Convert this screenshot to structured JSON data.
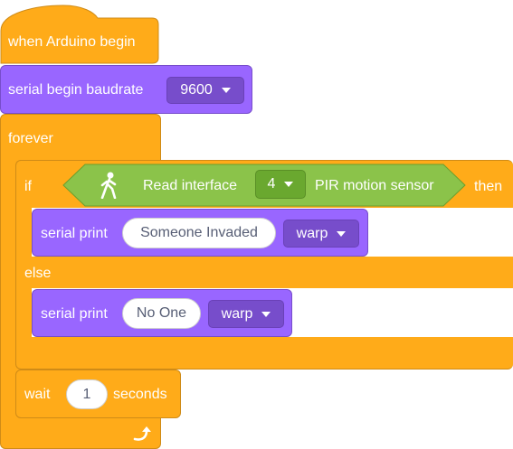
{
  "hat": {
    "label": "when Arduino begin"
  },
  "serial_begin": {
    "label": "serial begin baudrate",
    "baud": "9600"
  },
  "forever": {
    "label": "forever"
  },
  "if_block": {
    "if_label": "if",
    "then_label": "then",
    "else_label": "else",
    "condition": {
      "icon": "walking-person-icon",
      "label": "Read interface",
      "port": "4",
      "sensor": "PIR motion sensor"
    }
  },
  "print_invaded": {
    "label": "serial print",
    "text": "Someone Invaded",
    "mode": "warp"
  },
  "print_none": {
    "label": "serial print",
    "text": "No One",
    "mode": "warp"
  },
  "wait": {
    "label": "wait",
    "value": "1",
    "unit": "seconds"
  },
  "loop_icon": "loop-arrow-icon",
  "colors": {
    "control": "#ffab19",
    "control_border": "#cf8b17",
    "serial": "#9966ff",
    "serial_dark": "#774dcb",
    "sensor": "#8bc34a",
    "sensor_dark": "#6a9f2e"
  }
}
